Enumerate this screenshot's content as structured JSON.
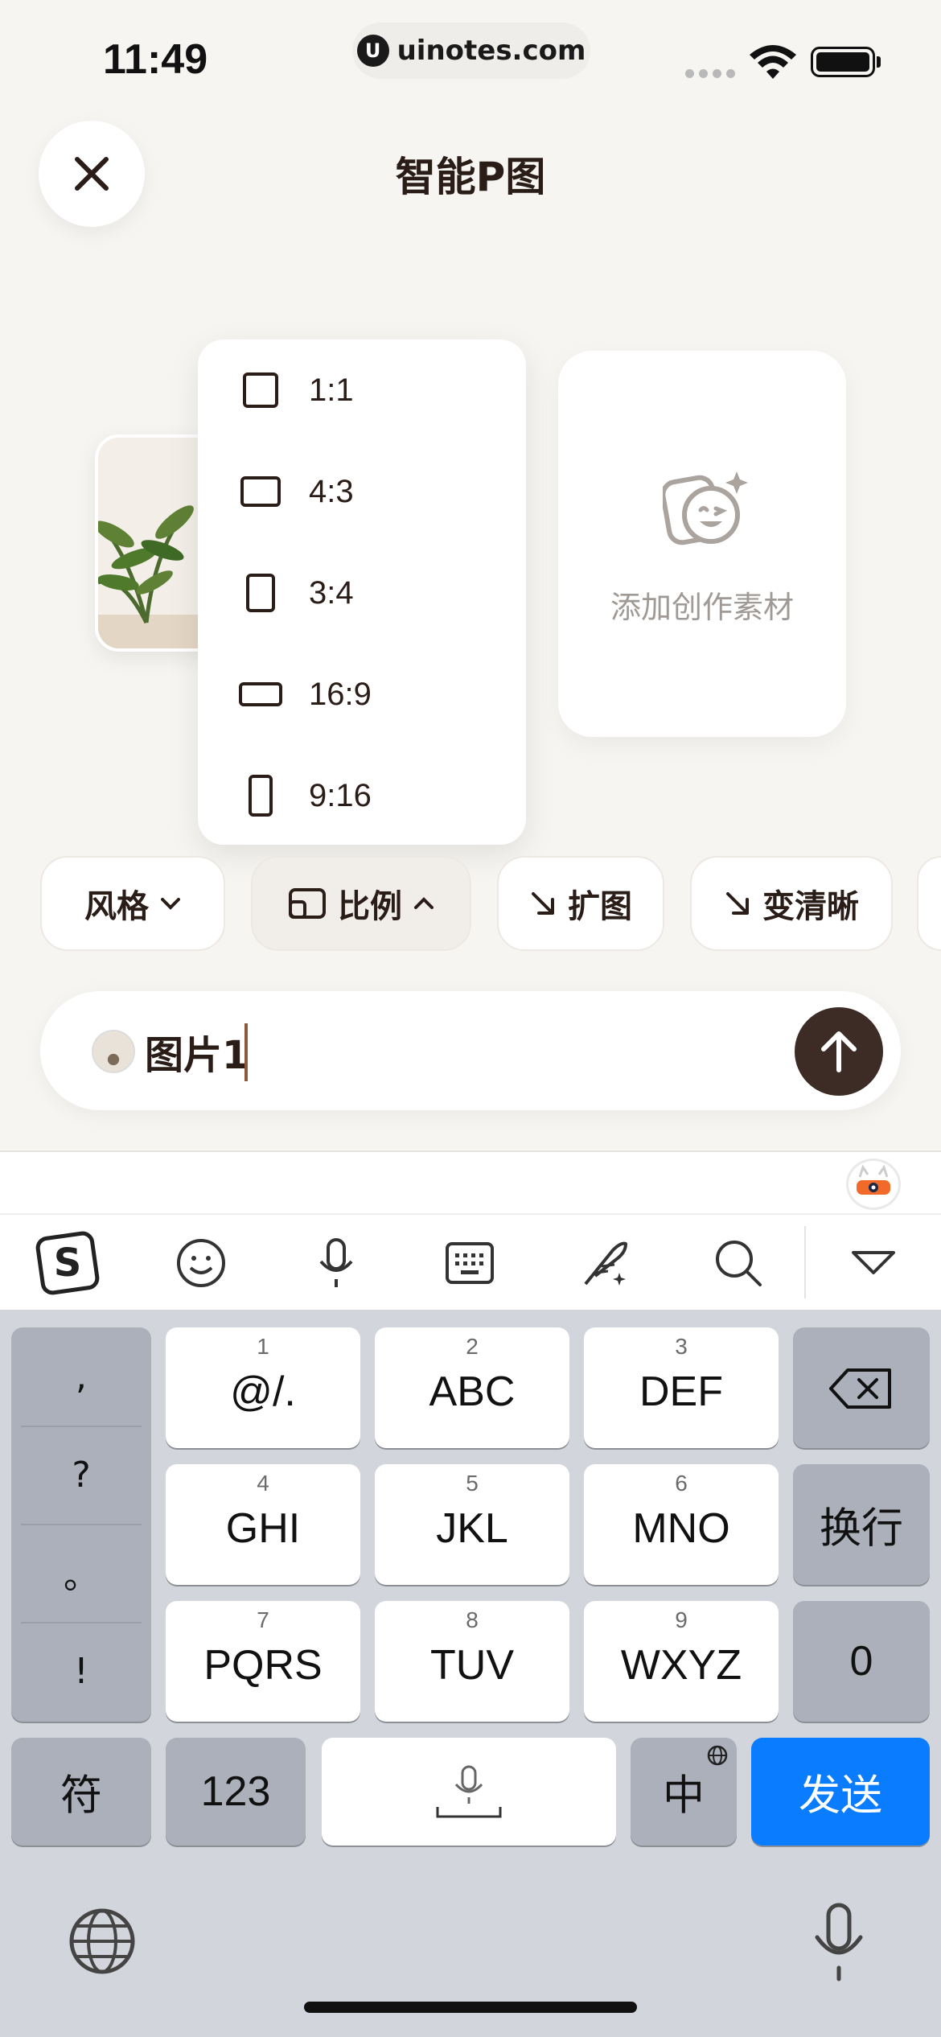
{
  "status_bar": {
    "time": "11:49",
    "site_logo": "U",
    "url": "uinotes.com"
  },
  "header": {
    "close_icon": "close-icon",
    "title": "智能P图"
  },
  "add_card": {
    "label": "添加创作素材",
    "icon": "add-material-icon"
  },
  "ratio_dropdown": {
    "items": [
      {
        "label": "1:1"
      },
      {
        "label": "4:3"
      },
      {
        "label": "3:4"
      },
      {
        "label": "16:9"
      },
      {
        "label": "9:16"
      }
    ]
  },
  "chips": {
    "style": "风格",
    "ratio": "比例",
    "expand": "扩图",
    "sharpen": "变清晰"
  },
  "input": {
    "value": "图片1"
  },
  "keyboard": {
    "punct": [
      ",",
      "?",
      "。",
      "!"
    ],
    "rows": [
      [
        {
          "num": "1",
          "label": "@/."
        },
        {
          "num": "2",
          "label": "ABC"
        },
        {
          "num": "3",
          "label": "DEF"
        }
      ],
      [
        {
          "num": "4",
          "label": "GHI"
        },
        {
          "num": "5",
          "label": "JKL"
        },
        {
          "num": "6",
          "label": "MNO"
        }
      ],
      [
        {
          "num": "7",
          "label": "PQRS"
        },
        {
          "num": "8",
          "label": "TUV"
        },
        {
          "num": "9",
          "label": "WXYZ"
        }
      ]
    ],
    "newline": "换行",
    "zero": "0",
    "symbols": "符",
    "numbers": "123",
    "lang": "中",
    "send": "发送"
  },
  "colors": {
    "background": "#f7f5f1",
    "accent_dark": "#3d2c25",
    "send_key": "#0a7cff"
  }
}
